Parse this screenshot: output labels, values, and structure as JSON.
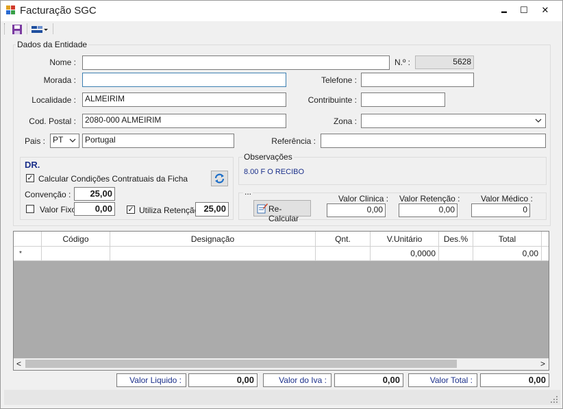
{
  "window": {
    "title": "Facturação SGC",
    "minimize": "▬",
    "maximize": "☐",
    "close": "✕"
  },
  "toolbar": {
    "save_icon": "save-icon",
    "layout_icon": "layout-dropdown-icon"
  },
  "entity": {
    "group_label": "Dados da Entidade",
    "nome_label": "Nome :",
    "nome_value": "",
    "numero_label": "N.º :",
    "numero_value": "5628",
    "morada_label": "Morada :",
    "morada_value": "",
    "telefone_label": "Telefone :",
    "telefone_value": "",
    "localidade_label": "Localidade :",
    "localidade_value": "ALMEIRIM",
    "contribuinte_label": "Contribuinte :",
    "contribuinte_value": "",
    "codpostal_label": "Cod. Postal :",
    "codpostal_value": "2080-000 ALMEIRIM",
    "zona_label": "Zona :",
    "zona_value": "",
    "pais_label": "Pais :",
    "pais_code": "PT",
    "pais_name": "Portugal",
    "referencia_label": "Referência :",
    "referencia_value": ""
  },
  "dr": {
    "title": "DR.",
    "calcular_label": "Calcular Condições Contratuais  da Ficha",
    "calcular_checked": "✓",
    "convencao_label": "Convenção :",
    "convencao_value": "25,00",
    "valorfixo_label": "Valor Fixo",
    "valorfixo_checked": "",
    "valorfixo_value": "0,00",
    "retencao_label": "Utiliza Retenção",
    "retencao_checked": "✓",
    "retencao_value": "25,00"
  },
  "observacoes": {
    "label": "Observações",
    "text": "8.00 F O RECIBO"
  },
  "calc": {
    "label": "...",
    "recalc_button": "Re-Calcular",
    "valor_clinica_label": "Valor Clinica :",
    "valor_clinica_value": "0,00",
    "valor_retencao_label": "Valor Retenção :",
    "valor_retencao_value": "0,00",
    "valor_medico_label": "Valor Médico :",
    "valor_medico_value": "0"
  },
  "grid": {
    "columns": [
      "Código",
      "Designação",
      "Qnt.",
      "V.Unitário",
      "Des.%",
      "Total"
    ],
    "new_row_marker": "*",
    "new_row": {
      "codigo": "",
      "designacao": "",
      "qnt": "",
      "vunitario": "0,0000",
      "desc": "",
      "total": "0,00"
    },
    "scroll_left": "<",
    "scroll_right": ">"
  },
  "totals": {
    "liquido_label": "Valor Liquido :",
    "liquido_value": "0,00",
    "iva_label": "Valor do Iva :",
    "iva_value": "0,00",
    "total_label": "Valor Total :",
    "total_value": "0,00"
  }
}
